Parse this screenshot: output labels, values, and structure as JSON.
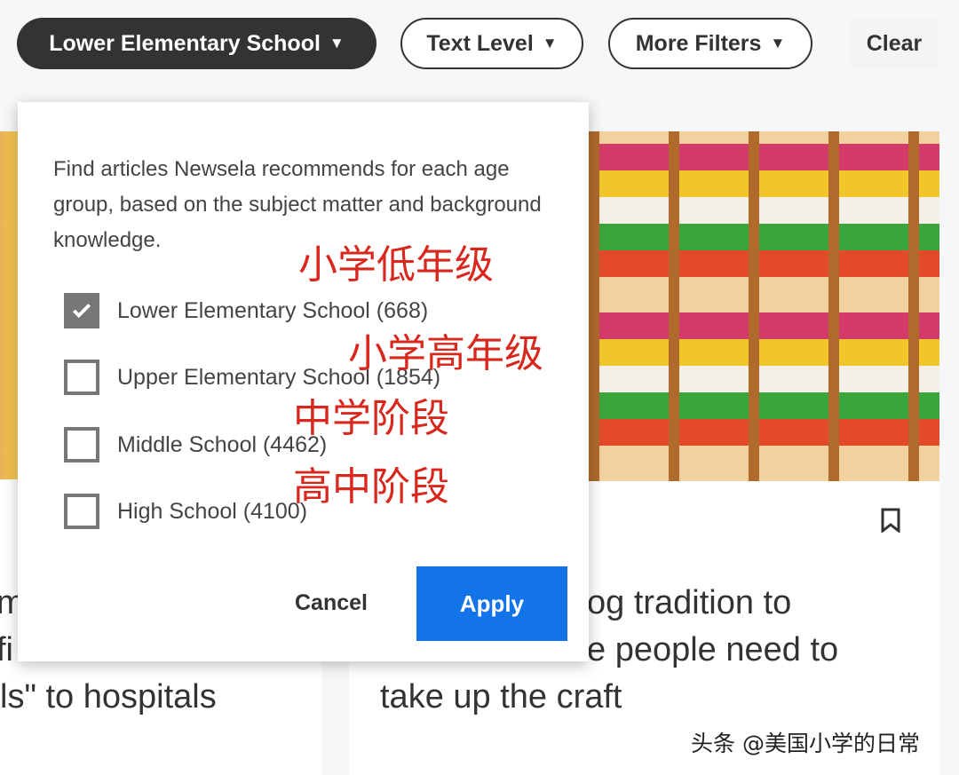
{
  "filters": {
    "grade": "Lower Elementary School",
    "text_level": "Text Level",
    "more": "More Filters",
    "clear": "Clear"
  },
  "cards": {
    "left": {
      "title_fragments": [
        "m",
        "fi",
        "ls\" to hospitals"
      ]
    },
    "right": {
      "title_fragments": [
        "og tradition to",
        "e people need to",
        "take up the craft"
      ]
    }
  },
  "dialog": {
    "description": "Find articles Newsela recommends for each age group, based on the subject matter and background knowledge.",
    "options": [
      {
        "label": "Lower Elementary School (668)",
        "checked": true
      },
      {
        "label": "Upper Elementary School (1854)",
        "checked": false
      },
      {
        "label": "Middle School (4462)",
        "checked": false
      },
      {
        "label": "High School (4100)",
        "checked": false
      }
    ],
    "cancel": "Cancel",
    "apply": "Apply"
  },
  "annotations": [
    "小学低年级",
    "小学高年级",
    "中学阶段",
    "高中阶段"
  ],
  "watermark": "头条 @美国小学的日常",
  "colors": {
    "accent": "#1373e8",
    "annotation": "#d8281e",
    "dark_pill": "#333333"
  }
}
